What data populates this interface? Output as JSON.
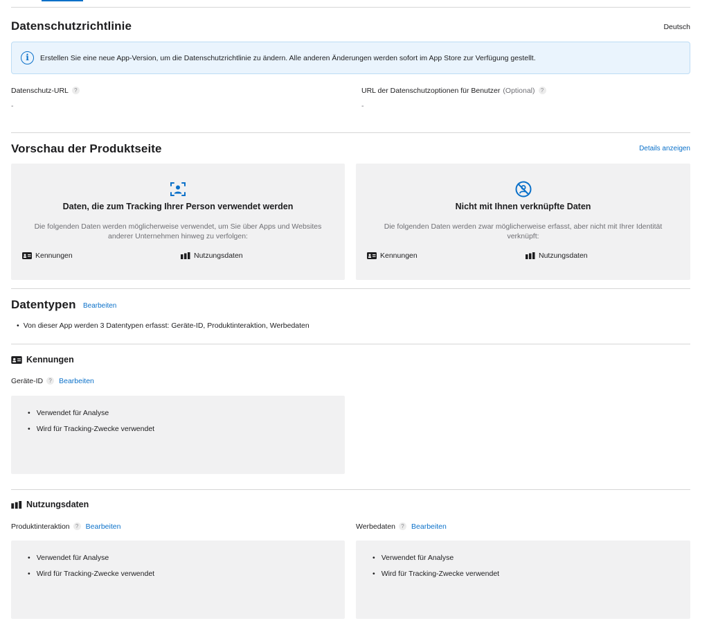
{
  "privacy_policy": {
    "title": "Datenschutzrichtlinie",
    "language": "Deutsch",
    "banner_text": "Erstellen Sie eine neue App-Version, um die Datenschutzrichtlinie zu ändern. Alle anderen Änderungen werden sofort im App Store zur Verfügung gestellt.",
    "privacy_url_label": "Datenschutz-URL",
    "privacy_url_value": "-",
    "choices_url_label": "URL der Datenschutzoptionen für Benutzer",
    "choices_url_optional": "(Optional)",
    "choices_url_value": "-"
  },
  "preview": {
    "title": "Vorschau der Produktseite",
    "details_link": "Details anzeigen",
    "cards": [
      {
        "icon": "person-tracking-icon",
        "title": "Daten, die zum Tracking Ihrer Person verwendet werden",
        "description": "Die folgenden Daten werden möglicherweise verwendet, um Sie über Apps und Websites anderer Unternehmen hinweg zu verfolgen:",
        "items": [
          {
            "icon": "id-card-icon",
            "label": "Kennungen"
          },
          {
            "icon": "bar-chart-icon",
            "label": "Nutzungsdaten"
          }
        ]
      },
      {
        "icon": "person-crossed-icon",
        "title": "Nicht mit Ihnen verknüpfte Daten",
        "description": "Die folgenden Daten werden zwar möglicherweise erfasst, aber nicht mit Ihrer Identität verknüpft:",
        "items": [
          {
            "icon": "id-card-icon",
            "label": "Kennungen"
          },
          {
            "icon": "bar-chart-icon",
            "label": "Nutzungsdaten"
          }
        ]
      }
    ]
  },
  "data_types": {
    "title": "Datentypen",
    "edit_link": "Bearbeiten",
    "summary": "Von dieser App werden 3 Datentypen erfasst: Geräte-ID, Produktinteraktion, Werbedaten"
  },
  "identifiers": {
    "title": "Kennungen",
    "device_id_label": "Geräte-ID",
    "edit_link": "Bearbeiten",
    "uses": [
      "Verwendet für Analyse",
      "Wird für Tracking-Zwecke verwendet"
    ]
  },
  "usage_data": {
    "title": "Nutzungsdaten",
    "product_interaction": {
      "label": "Produktinteraktion",
      "edit_link": "Bearbeiten",
      "uses": [
        "Verwendet für Analyse",
        "Wird für Tracking-Zwecke verwendet"
      ]
    },
    "advertising": {
      "label": "Werbedaten",
      "edit_link": "Bearbeiten",
      "uses": [
        "Verwendet für Analyse",
        "Wird für Tracking-Zwecke verwendet"
      ]
    }
  },
  "help_glyph": "?",
  "colors": {
    "accent": "#0a70c9",
    "card_bg": "#f1f1f2",
    "banner_bg": "#eaf4fd"
  }
}
